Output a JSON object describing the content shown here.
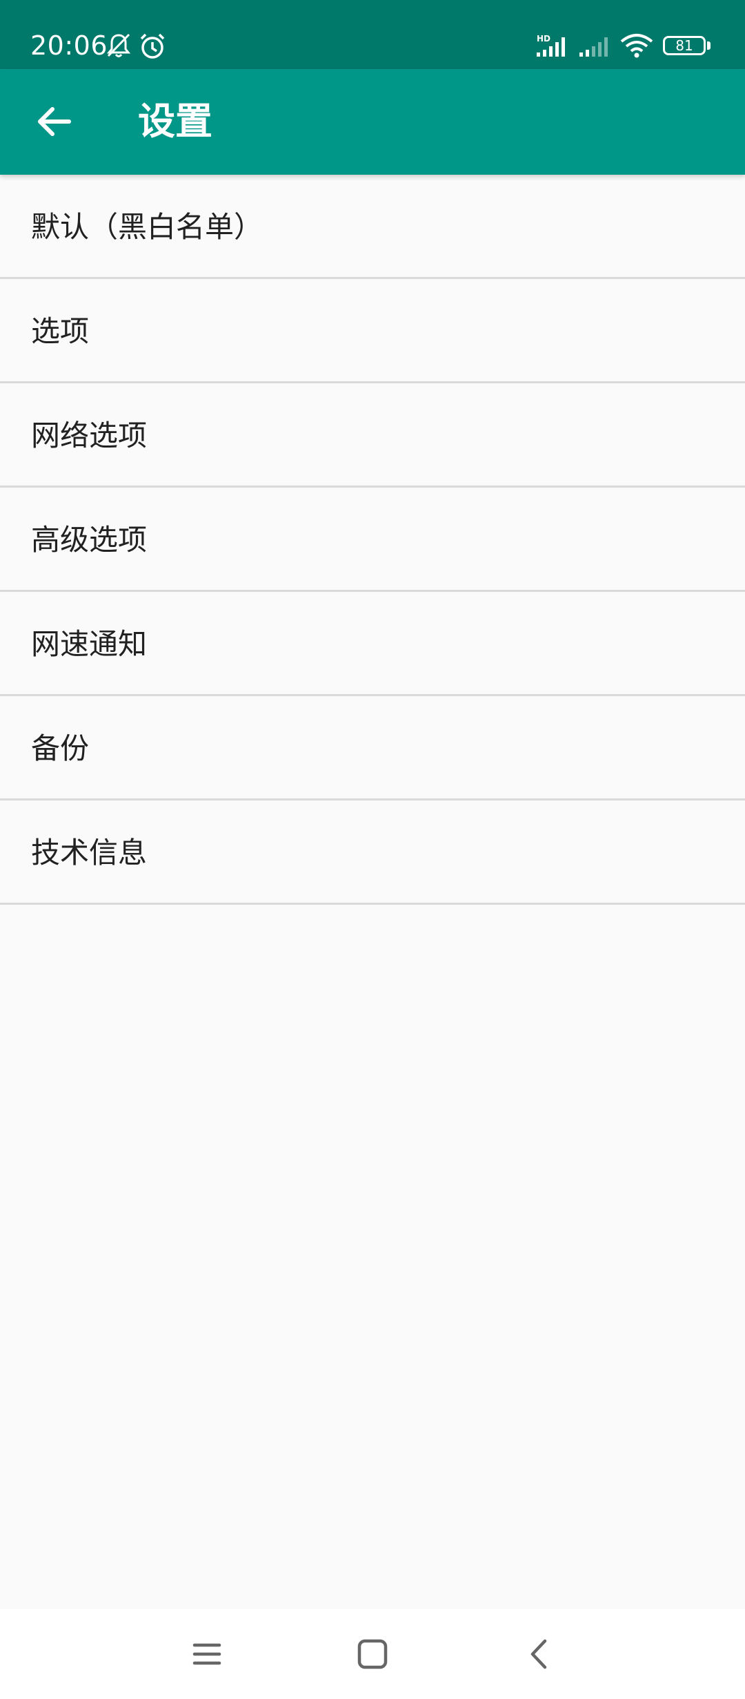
{
  "status_bar": {
    "time": "20:06",
    "battery_level": "81",
    "icons": [
      "bell-off-icon",
      "alarm-icon",
      "hd-signal-icon",
      "signal-icon",
      "wifi-icon",
      "battery-icon"
    ]
  },
  "app_bar": {
    "title": "设置",
    "back_icon": "arrow-left-icon"
  },
  "settings": {
    "items": [
      {
        "label": "默认（黑白名单）"
      },
      {
        "label": "选项"
      },
      {
        "label": "网络选项"
      },
      {
        "label": "高级选项"
      },
      {
        "label": "网速通知"
      },
      {
        "label": "备份"
      },
      {
        "label": "技术信息"
      }
    ]
  },
  "nav_bar": {
    "buttons": [
      "menu-icon",
      "home-icon",
      "back-chevron-icon"
    ]
  },
  "colors": {
    "status_bar": "#00796b",
    "app_bar": "#009688",
    "background": "#fafafa",
    "divider": "#d9d9d9",
    "text": "#212121"
  }
}
